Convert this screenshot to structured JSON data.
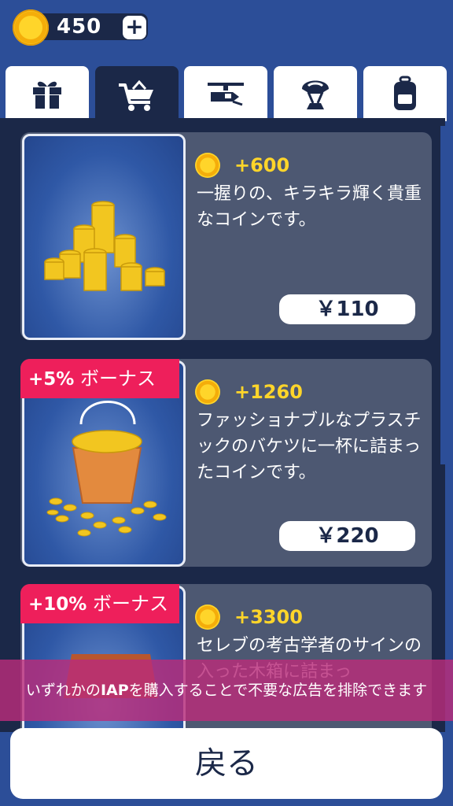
{
  "header": {
    "coin_count": "450",
    "plus_label": "+"
  },
  "tabs": [
    {
      "icon": "gift-icon",
      "active": false
    },
    {
      "icon": "shopping-cart-icon",
      "active": true
    },
    {
      "icon": "helicopter-icon",
      "active": false
    },
    {
      "icon": "parachute-icon",
      "active": false
    },
    {
      "icon": "backpack-icon",
      "active": false
    }
  ],
  "items": [
    {
      "amount": "+600",
      "description": "一握りの、キラキラ輝く貴重なコインです。",
      "price": "￥110",
      "bonus_pct": "",
      "bonus_label": ""
    },
    {
      "amount": "+1260",
      "description": "ファッショナブルなプラスチックのバケツに一杯に詰まったコインです。",
      "price": "￥220",
      "bonus_pct": "+5%",
      "bonus_label": "ボーナス"
    },
    {
      "amount": "+3300",
      "description": "セレブの考古学者のサインの入った木箱に詰まっ",
      "price": "",
      "bonus_pct": "+10%",
      "bonus_label": "ボーナス"
    }
  ],
  "banner": {
    "prefix": "いずれかの",
    "iap": "IAP",
    "suffix": "を購入することで不要な広告を排除できます"
  },
  "back_button": "戻る",
  "colors": {
    "background": "#2c4e98",
    "panel": "#1b2848",
    "card": "#4d5872",
    "coin_text": "#ffd52a",
    "bonus": "#ee1f5b",
    "banner": "#ba2c7a"
  }
}
